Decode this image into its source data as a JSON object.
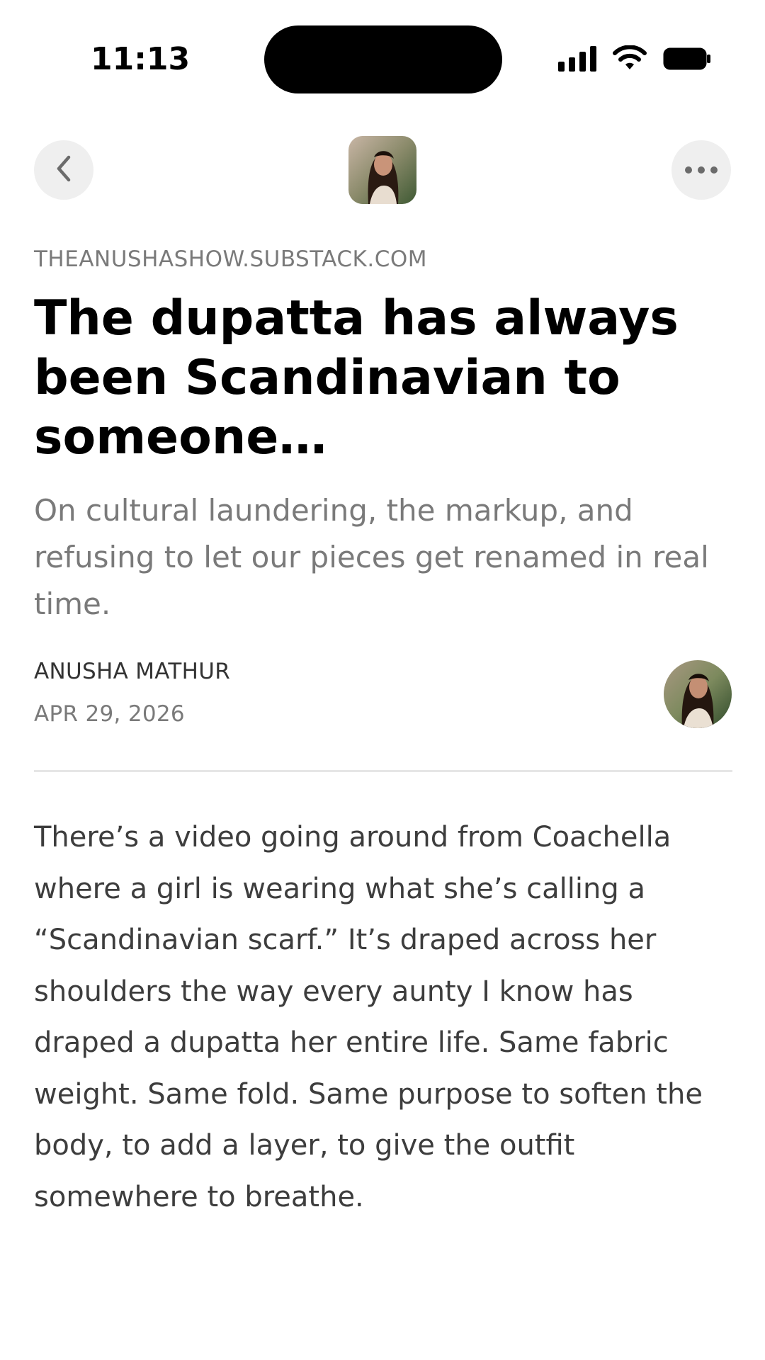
{
  "status_bar": {
    "time": "11:13",
    "icons": [
      "signal-icon",
      "wifi-icon",
      "battery-icon"
    ]
  },
  "nav": {
    "back_icon": "chevron-left-icon",
    "more_icon": "ellipsis-icon",
    "logo": "publication-logo-photo"
  },
  "article": {
    "publication_domain": "THEANUSHASHOW.SUBSTACK.COM",
    "title": "The dupatta has always been Scandinavian to someone…",
    "subtitle": "On cultural laundering, the markup, and refusing to let our pieces get renamed in real time.",
    "author": "ANUSHA MATHUR",
    "date": "APR 29, 2026",
    "body": "There’s a video going around from Coachella where a girl is wearing what she’s calling a “Scandinavian scarf.” It’s draped across her shoulders the way every aunty I know has draped a dupatta her entire life. Same fabric weight. Same fold. Same purpose to soften the body, to add a layer, to give the outfit somewhere to breathe."
  },
  "colors": {
    "background": "#ffffff",
    "title": "#000000",
    "muted": "#7a7a7a",
    "body": "#3d3d3d",
    "button_bg": "#efefef",
    "divider": "#e6e6e6"
  }
}
